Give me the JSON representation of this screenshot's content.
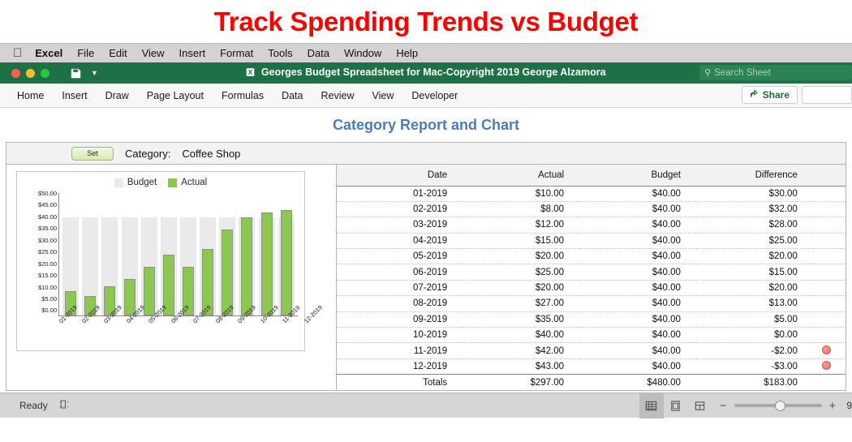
{
  "banner": {
    "title": "Track Spending Trends vs Budget",
    "color": "#ff0000"
  },
  "menubar": {
    "apple_icon": "apple-logo",
    "items": [
      {
        "label": "Excel",
        "bold": true
      },
      {
        "label": "File"
      },
      {
        "label": "Edit"
      },
      {
        "label": "View"
      },
      {
        "label": "Insert"
      },
      {
        "label": "Format"
      },
      {
        "label": "Tools"
      },
      {
        "label": "Data"
      },
      {
        "label": "Window"
      },
      {
        "label": "Help"
      }
    ]
  },
  "titlebar": {
    "document_title": "Georges Budget Spreadsheet for Mac-Copyright 2019 George Alzamora",
    "background": "#1e7145",
    "search_placeholder": "Search Sheet",
    "save_icon": "floppy-disk-icon",
    "caret_icon": "chevron-down-icon"
  },
  "ribbon": {
    "tabs": [
      "Home",
      "Insert",
      "Draw",
      "Page Layout",
      "Formulas",
      "Data",
      "Review",
      "View",
      "Developer"
    ],
    "share_label": "Share",
    "share_color": "#15713f"
  },
  "sheet": {
    "report_heading": "Category Report and Chart",
    "heading_color": "#4a7ebb",
    "set_button_label": "Set",
    "category_label": "Category:",
    "category_value": "Coffee Shop"
  },
  "table": {
    "headers": [
      "Date",
      "Actual",
      "Budget",
      "Difference"
    ],
    "rows": [
      {
        "date": "01-2019",
        "actual": "$10.00",
        "budget": "$40.00",
        "difference": "$30.00",
        "flag": false
      },
      {
        "date": "02-2019",
        "actual": "$8.00",
        "budget": "$40.00",
        "difference": "$32.00",
        "flag": false
      },
      {
        "date": "03-2019",
        "actual": "$12.00",
        "budget": "$40.00",
        "difference": "$28.00",
        "flag": false
      },
      {
        "date": "04-2019",
        "actual": "$15.00",
        "budget": "$40.00",
        "difference": "$25.00",
        "flag": false
      },
      {
        "date": "05-2019",
        "actual": "$20.00",
        "budget": "$40.00",
        "difference": "$20.00",
        "flag": false
      },
      {
        "date": "06-2019",
        "actual": "$25.00",
        "budget": "$40.00",
        "difference": "$15.00",
        "flag": false
      },
      {
        "date": "07-2019",
        "actual": "$20.00",
        "budget": "$40.00",
        "difference": "$20.00",
        "flag": false
      },
      {
        "date": "08-2019",
        "actual": "$27.00",
        "budget": "$40.00",
        "difference": "$13.00",
        "flag": false
      },
      {
        "date": "09-2019",
        "actual": "$35.00",
        "budget": "$40.00",
        "difference": "$5.00",
        "flag": false
      },
      {
        "date": "10-2019",
        "actual": "$40.00",
        "budget": "$40.00",
        "difference": "$0.00",
        "flag": false
      },
      {
        "date": "11-2019",
        "actual": "$42.00",
        "budget": "$40.00",
        "difference": "-$2.00",
        "flag": true
      },
      {
        "date": "12-2019",
        "actual": "$43.00",
        "budget": "$40.00",
        "difference": "-$3.00",
        "flag": true
      }
    ],
    "totals": {
      "date": "Totals",
      "actual": "$297.00",
      "budget": "$480.00",
      "difference": "$183.00"
    }
  },
  "chart_data": {
    "type": "bar",
    "title": "",
    "xlabel": "",
    "ylabel": "",
    "ylim": [
      0,
      50
    ],
    "ytick_labels": [
      "$50.00",
      "$45.00",
      "$40.00",
      "$35.00",
      "$30.00",
      "$25.00",
      "$20.00",
      "$15.00",
      "$10.00",
      "$5.00",
      "$0.00"
    ],
    "grid": false,
    "legend_position": "top-center",
    "categories": [
      "01-2019",
      "02-2019",
      "03-2019",
      "04-2019",
      "05-2019",
      "06-2019",
      "07-2019",
      "08-2019",
      "09-2019",
      "10-2019",
      "11-2019",
      "12-2019"
    ],
    "series": [
      {
        "name": "Budget",
        "color": "#eaeaea",
        "values": [
          40,
          40,
          40,
          40,
          40,
          40,
          40,
          40,
          40,
          40,
          40,
          40
        ]
      },
      {
        "name": "Actual",
        "color": "#8cc751",
        "values": [
          10,
          8,
          12,
          15,
          20,
          25,
          20,
          27,
          35,
          40,
          42,
          43
        ]
      }
    ]
  },
  "statusbar": {
    "ready_label": "Ready",
    "layout_icon": "page-layout-icon",
    "views": [
      "normal-view-icon",
      "page-layout-view-icon",
      "page-break-view-icon"
    ],
    "zoom_out": "−",
    "zoom_in": "+",
    "zoom_percent": "9"
  }
}
